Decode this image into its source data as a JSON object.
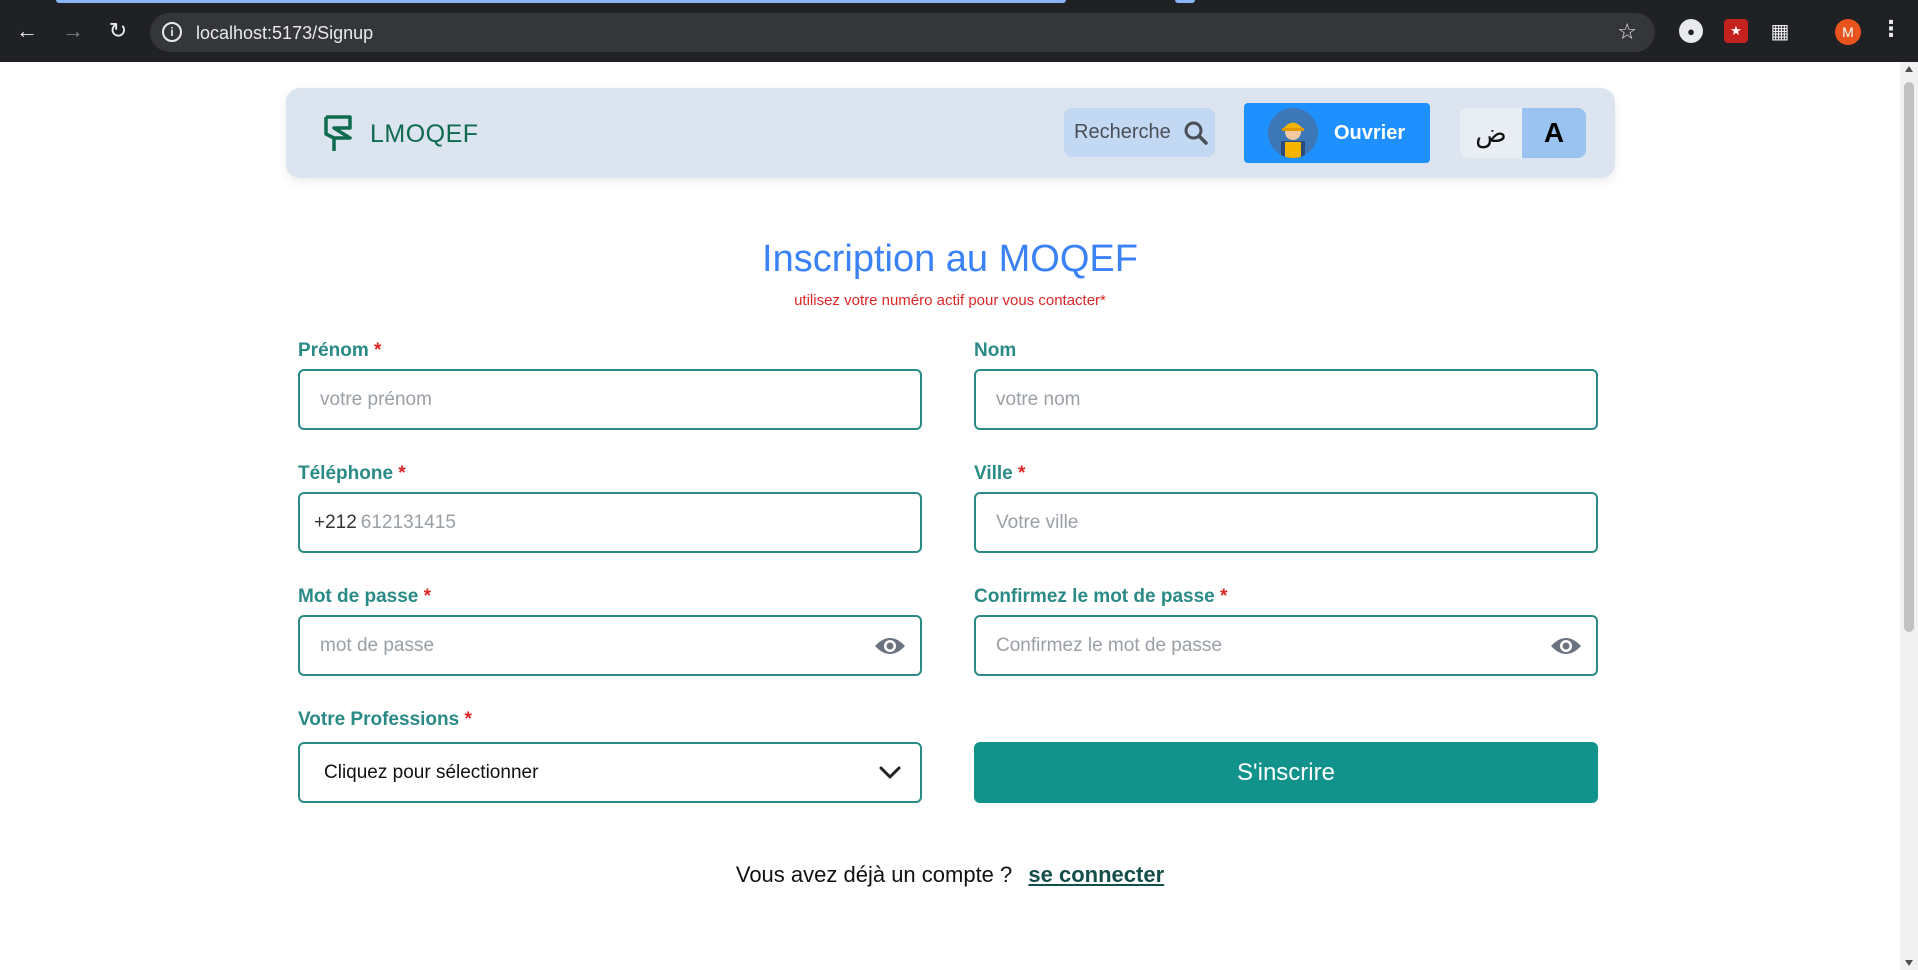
{
  "browser": {
    "url": "localhost:5173/Signup",
    "profile_initial": "M"
  },
  "navbar": {
    "brand": "LMOQEF",
    "search_label": "Recherche",
    "user_button_label": "Ouvrier",
    "lang_arabic": "ض",
    "lang_latin": "A"
  },
  "form": {
    "title": "Inscription au MOQEF",
    "subtitle": "utilisez votre numéro actif pour vous contacter*",
    "required_mark": "*",
    "fields": {
      "prenom": {
        "label": "Prénom",
        "placeholder": "votre prénom",
        "required": true
      },
      "nom": {
        "label": "Nom",
        "placeholder": "votre nom",
        "required": false
      },
      "telephone": {
        "label": "Téléphone",
        "prefix": "+212",
        "placeholder": "612131415",
        "required": true
      },
      "ville": {
        "label": "Ville",
        "placeholder": "Votre ville",
        "required": true
      },
      "password": {
        "label": "Mot de passe",
        "placeholder": "mot de passe",
        "required": true
      },
      "confirm_password": {
        "label": "Confirmez le mot de passe",
        "placeholder": "Confirmez le mot de passe",
        "required": true
      },
      "profession": {
        "label": "Votre Professions",
        "selected": "Cliquez pour sélectionner",
        "required": true
      }
    },
    "submit_label": "S'inscrire"
  },
  "footer": {
    "question": "Vous avez déjà un compte ?",
    "login_link": "se connecter"
  },
  "colors": {
    "accent_teal": "#11928a",
    "title_blue": "#3b82f6",
    "required_red": "#dc2626",
    "navbar_bg": "#dbe4ef",
    "user_button_blue": "#1e90ff"
  }
}
